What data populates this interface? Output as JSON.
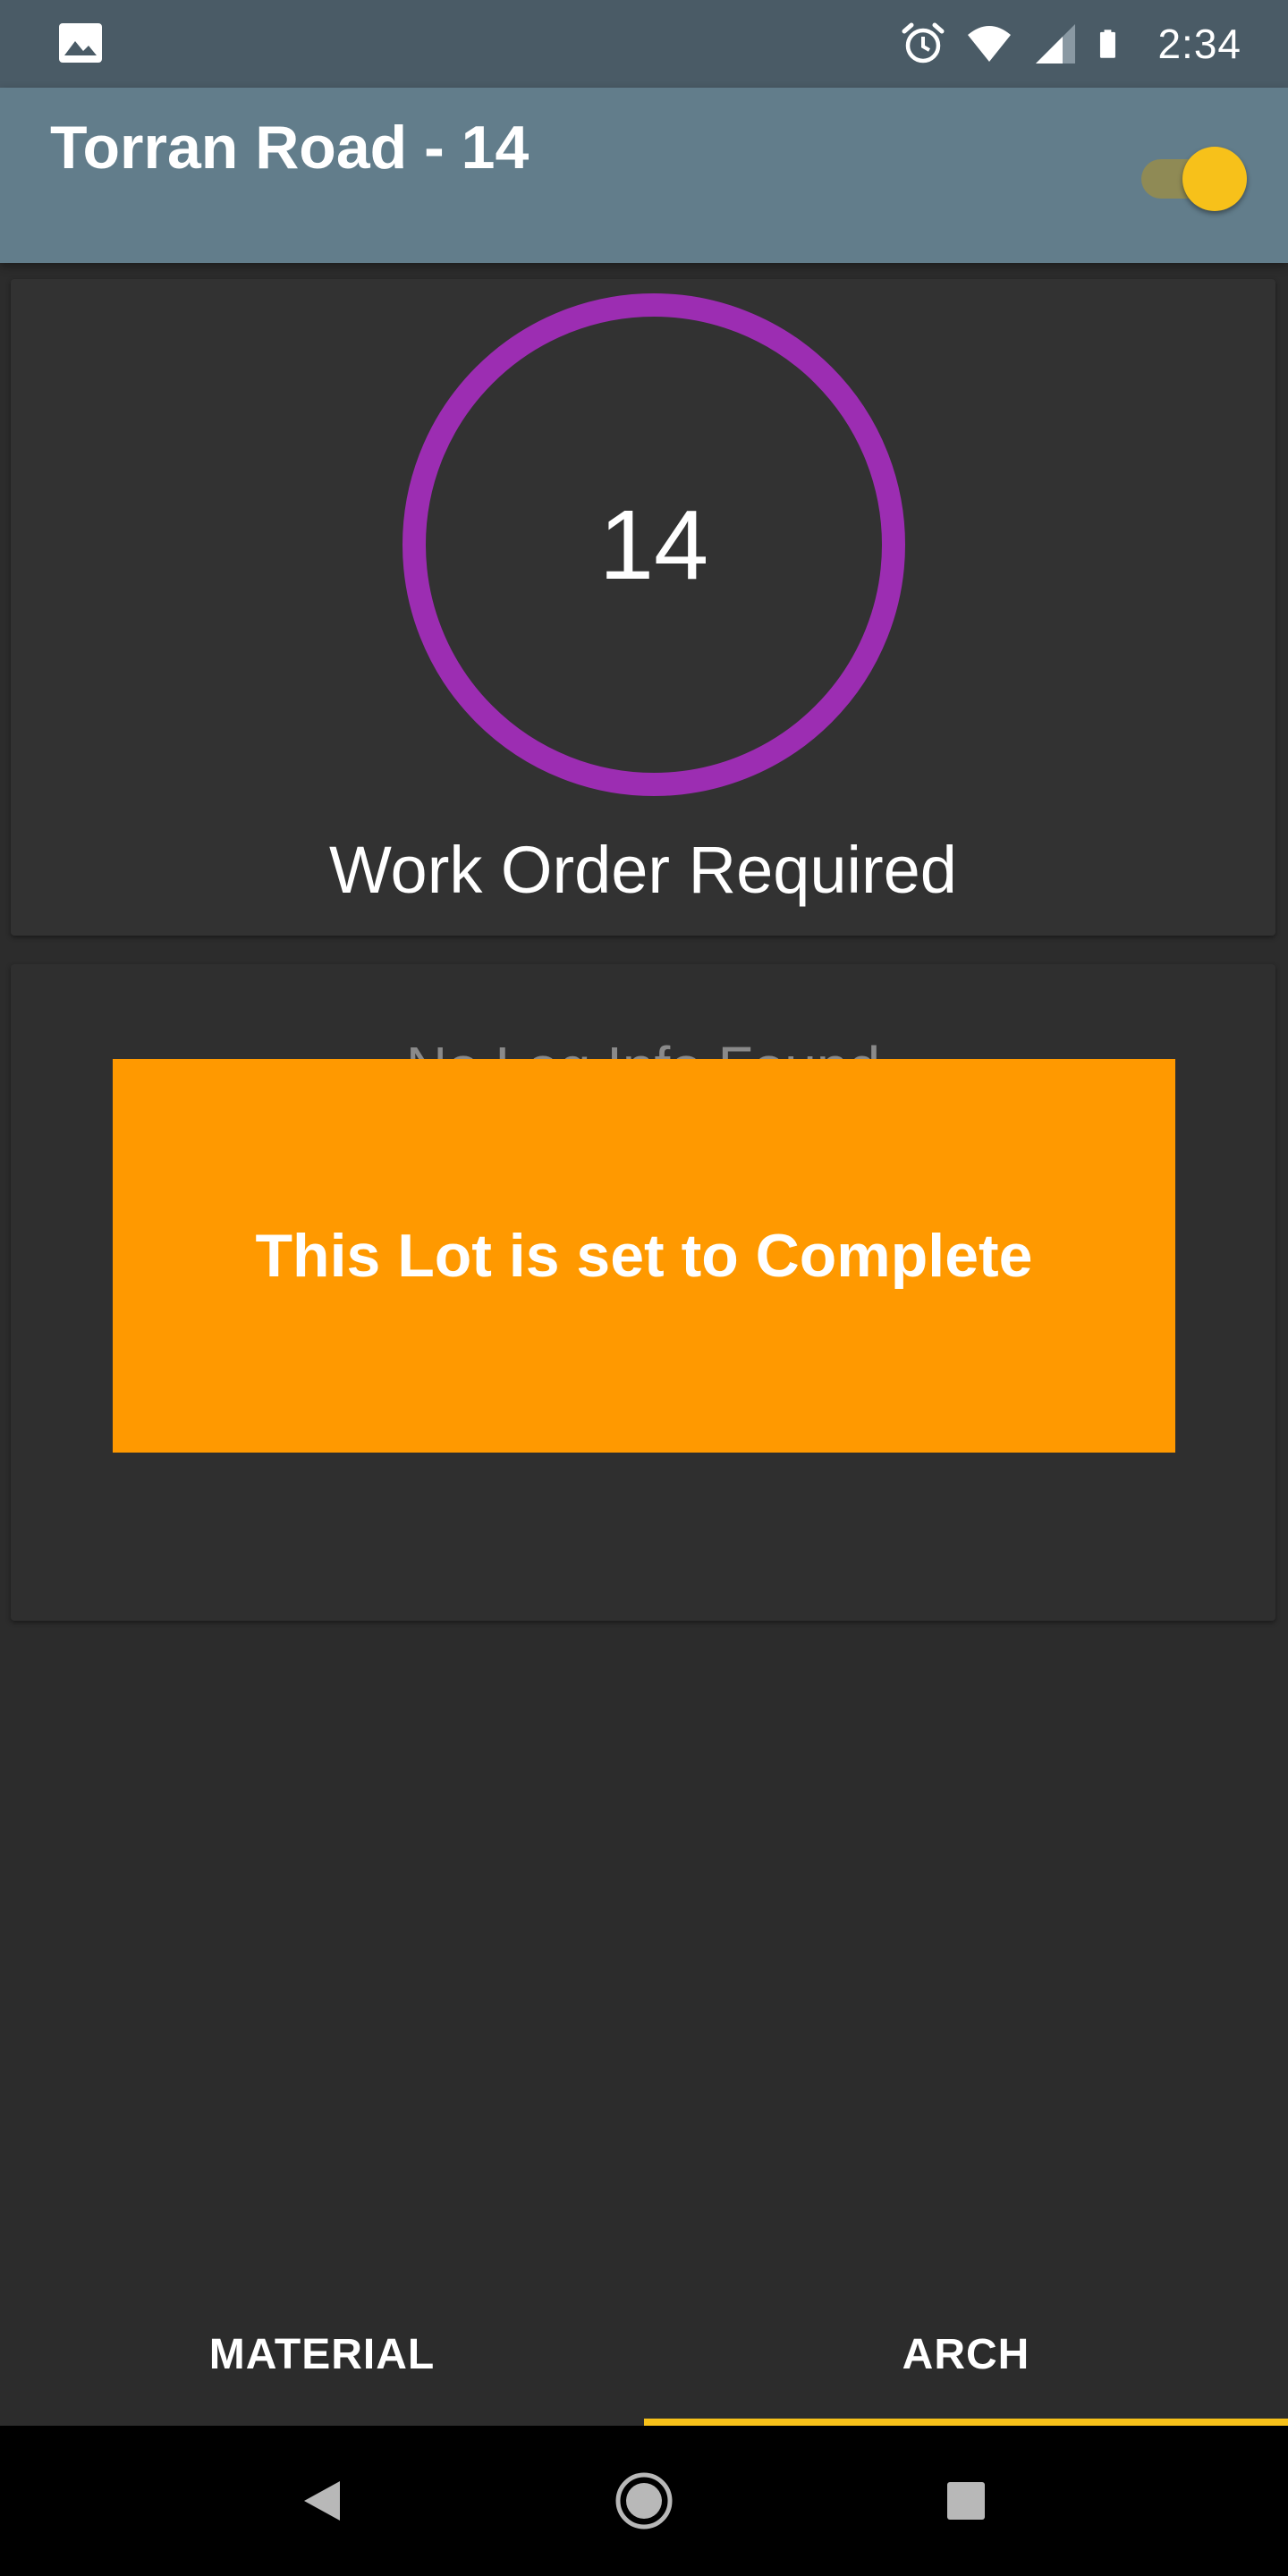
{
  "status_bar": {
    "time": "2:34",
    "icons": [
      "gallery-icon",
      "alarm-icon",
      "wifi-icon",
      "signal-icon",
      "battery-icon"
    ]
  },
  "app_bar": {
    "title": "Torran Road - 14",
    "toggle_on": true
  },
  "counter_card": {
    "value": "14",
    "label": "Work Order Required",
    "ring_color": "#9c2db2"
  },
  "log_card": {
    "empty_text": "No Log Info Found"
  },
  "toast": {
    "message": "This Lot is set to Complete",
    "color": "#ff9900"
  },
  "tabs": [
    {
      "label": "MATERIAL",
      "selected": false
    },
    {
      "label": "ARCH",
      "selected": true
    }
  ],
  "accent_color": "#f7c11a",
  "nav_bar": {
    "buttons": [
      "back-icon",
      "home-icon",
      "recents-icon"
    ]
  }
}
